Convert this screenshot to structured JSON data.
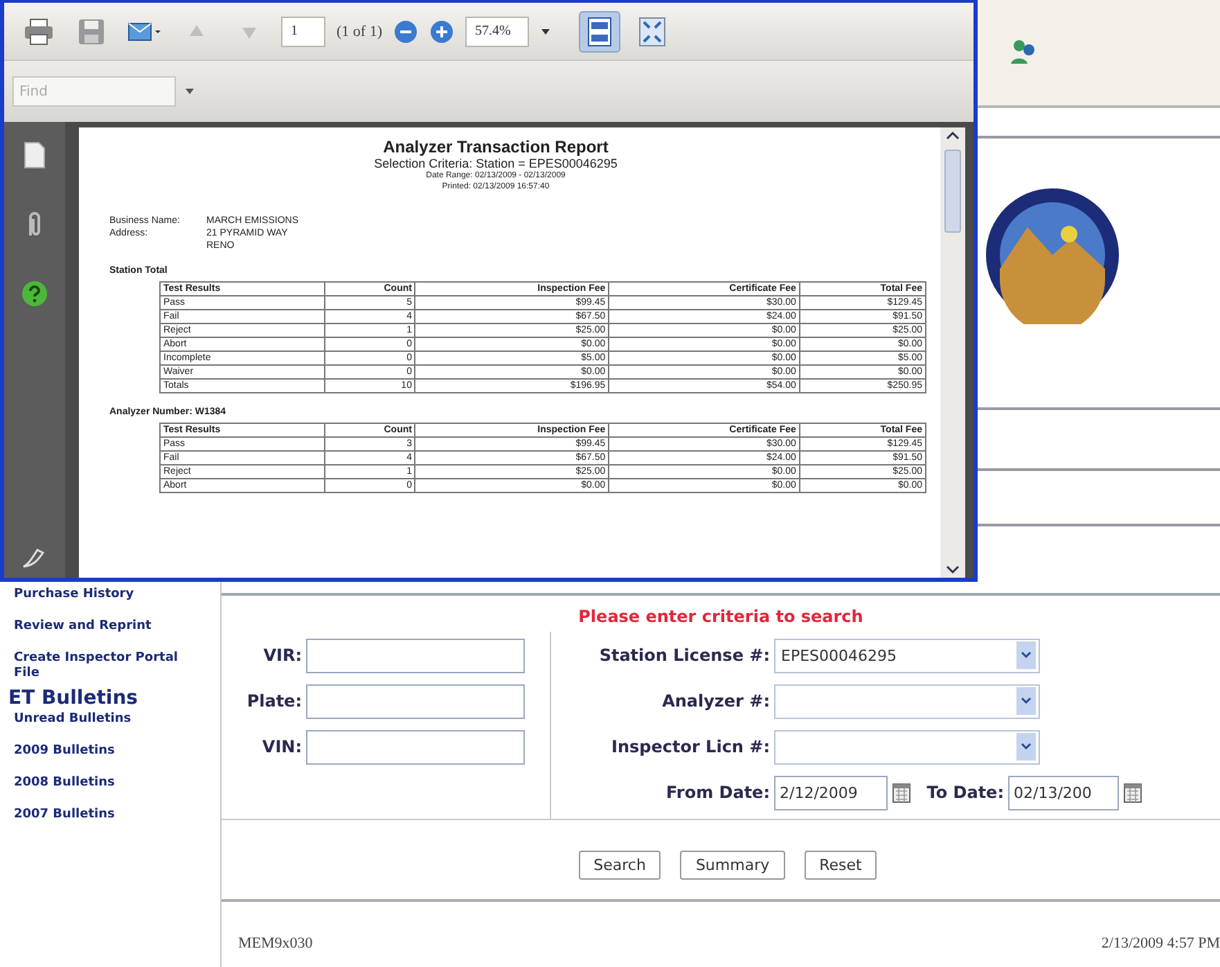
{
  "pdf_viewer": {
    "toolbar": {
      "page": "1",
      "page_count": "(1 of 1)",
      "zoom": "57.4%",
      "find_placeholder": "Find",
      "nav_buttons": [
        {
          "kind": "previous",
          "disabled": true
        },
        {
          "kind": "next",
          "disabled": true
        }
      ],
      "view_buttons": [
        {
          "kind": "fit-page",
          "selected": true
        },
        {
          "kind": "full-screen",
          "selected": false
        }
      ]
    },
    "document": {
      "title": "Analyzer Transaction Report",
      "criteria": "Selection Criteria: Station = EPES00046295",
      "date_range": "Date Range: 02/13/2009 - 02/13/2009",
      "printed": "Printed: 02/13/2009 16:57:40",
      "info": [
        {
          "label": "Business Name:",
          "lines": [
            "MARCH EMISSIONS"
          ]
        },
        {
          "label": "Address:",
          "lines": [
            "21 PYRAMID WAY",
            "RENO"
          ]
        }
      ],
      "sections": [
        {
          "heading": "Station Total",
          "columns": [
            "Test Results",
            "Count",
            "Inspection Fee",
            "Certificate Fee",
            "Total Fee"
          ],
          "rows": [
            [
              "Pass",
              "5",
              "$99.45",
              "$30.00",
              "$129.45"
            ],
            [
              "Fail",
              "4",
              "$67.50",
              "$24.00",
              "$91.50"
            ],
            [
              "Reject",
              "1",
              "$25.00",
              "$0.00",
              "$25.00"
            ],
            [
              "Abort",
              "0",
              "$0.00",
              "$0.00",
              "$0.00"
            ],
            [
              "Incomplete",
              "0",
              "$5.00",
              "$0.00",
              "$5.00"
            ],
            [
              "Waiver",
              "0",
              "$0.00",
              "$0.00",
              "$0.00"
            ],
            [
              "Totals",
              "10",
              "$196.95",
              "$54.00",
              "$250.95"
            ]
          ]
        },
        {
          "heading": "Analyzer Number: W1384",
          "columns": [
            "Test Results",
            "Count",
            "Inspection Fee",
            "Certificate Fee",
            "Total Fee"
          ],
          "rows": [
            [
              "Pass",
              "3",
              "$99.45",
              "$30.00",
              "$129.45"
            ],
            [
              "Fail",
              "4",
              "$67.50",
              "$24.00",
              "$91.50"
            ],
            [
              "Reject",
              "1",
              "$25.00",
              "$0.00",
              "$25.00"
            ],
            [
              "Abort",
              "0",
              "$0.00",
              "$0.00",
              "$0.00"
            ]
          ]
        }
      ]
    }
  },
  "sidebar": {
    "items": [
      {
        "kind": "link",
        "label": "Purchase History"
      },
      {
        "kind": "link",
        "label": "Review and Reprint"
      },
      {
        "kind": "link",
        "label": "Create Inspector Portal File"
      },
      {
        "kind": "heading",
        "label": "ET Bulletins"
      },
      {
        "kind": "link",
        "label": "Unread Bulletins"
      },
      {
        "kind": "link",
        "label": "2009 Bulletins"
      },
      {
        "kind": "link",
        "label": "2008 Bulletins"
      },
      {
        "kind": "link",
        "label": "2007 Bulletins"
      }
    ]
  },
  "search_form": {
    "title": "Please enter criteria to search",
    "left_fields": [
      {
        "label": "VIR:"
      },
      {
        "label": "Plate:"
      },
      {
        "label": "VIN:"
      }
    ],
    "right_fields": [
      {
        "label": "Station License #:",
        "value": "EPES00046295"
      },
      {
        "label": "Analyzer #:"
      },
      {
        "label": "Inspector Licn #:"
      }
    ],
    "from_date": {
      "label": "From Date:",
      "value": "2/12/2009"
    },
    "to_date": {
      "label": "To Date:",
      "value": "02/13/200"
    },
    "buttons": [
      "Search",
      "Summary",
      "Reset"
    ]
  },
  "footer": {
    "code": "MEM9x030",
    "timestamp": "2/13/2009 4:57 PM"
  }
}
